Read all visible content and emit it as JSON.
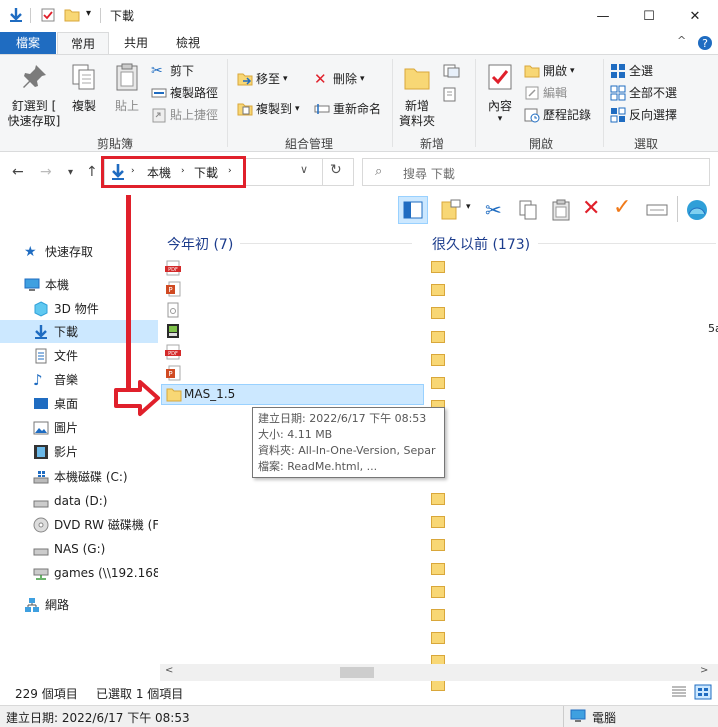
{
  "window": {
    "title": "下載",
    "minimize": "—",
    "maximize": "☐",
    "close": "✕"
  },
  "ribbon_tabs": [
    "檔案",
    "常用",
    "共用",
    "檢視"
  ],
  "ribbon": {
    "clipboard": {
      "pin": "釘選到 [\n快速存取]",
      "copy": "複製",
      "paste": "貼上",
      "cut": "剪下",
      "copy_path": "複製路徑",
      "paste_shortcut": "貼上捷徑",
      "label": "剪貼簿"
    },
    "organize": {
      "move_to": "移至",
      "copy_to": "複製到",
      "delete": "刪除",
      "rename": "重新命名",
      "label": "組合管理"
    },
    "new": {
      "new_folder": "新增\n資料夾",
      "label": "新增"
    },
    "open": {
      "properties": "內容",
      "open": "開啟",
      "edit": "編輯",
      "history": "歷程記錄",
      "label": "開啟"
    },
    "select": {
      "select_all": "全選",
      "select_none": "全部不選",
      "invert": "反向選擇",
      "label": "選取"
    }
  },
  "address": {
    "crumbs": [
      "本機",
      "下載"
    ],
    "search_placeholder": "搜尋 下載"
  },
  "nav": {
    "quick_access": "快速存取",
    "this_pc": "本機",
    "objects3d": "3D 物件",
    "downloads": "下載",
    "documents": "文件",
    "music": "音樂",
    "desktop": "桌面",
    "pictures": "圖片",
    "videos": "影片",
    "local_disk": "本機磁碟 (C:)",
    "data": "data (D:)",
    "dvd": "DVD RW 磁碟機 (F:",
    "nas": "NAS (G:)",
    "games": "games (\\\\192.168.",
    "network": "網路"
  },
  "content": {
    "group_recent": "今年初 (7)",
    "group_old": "很久以前 (173)",
    "selected_folder": "MAS_1.5",
    "clipped_text": "5a",
    "tooltip": {
      "created": "建立日期: 2022/6/17 下午 08:53",
      "size": "大小: 4.11 MB",
      "folders": "資料夾: All-In-One-Version, Separ",
      "files": "檔案: ReadMe.html, ..."
    }
  },
  "status": {
    "count": "229 個項目",
    "selected": "已選取 1 個項目",
    "bottom_left": "建立日期: 2022/6/17 下午 08:53",
    "bottom_right": "電腦"
  },
  "colors": {
    "accent": "#1f6cc1",
    "selection": "#cce8ff",
    "annotation_red": "#e0202b",
    "folder_yellow": "#f8d775"
  }
}
